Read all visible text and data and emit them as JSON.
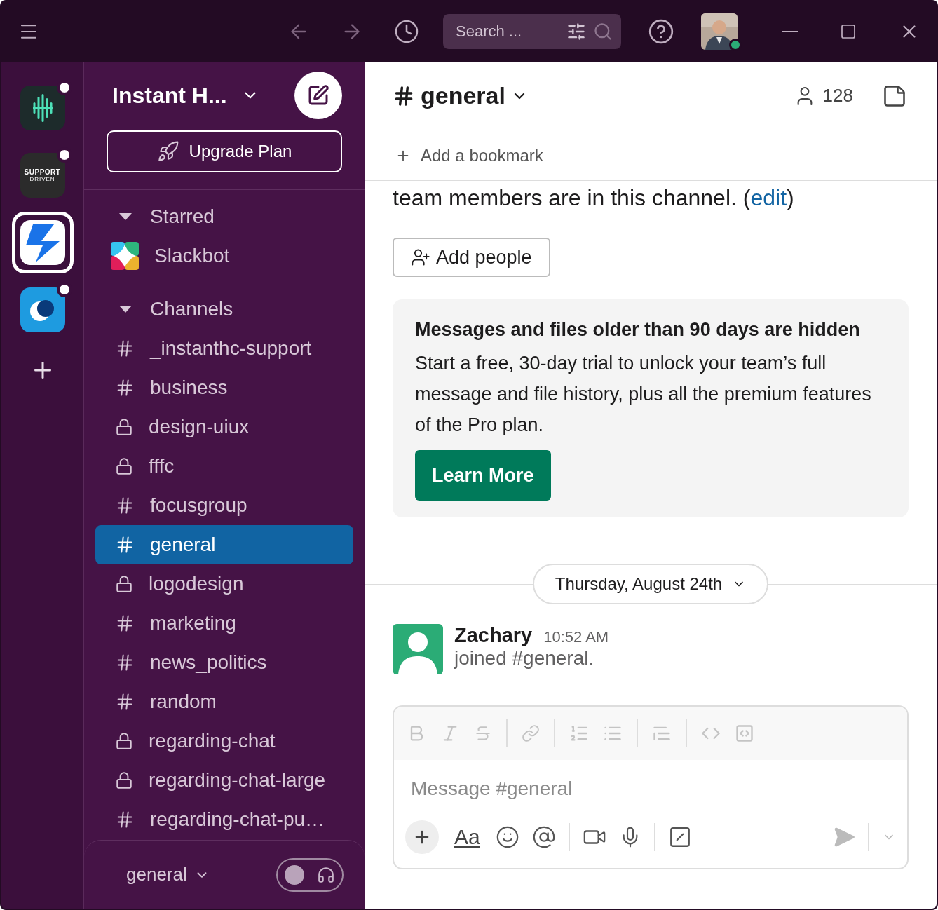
{
  "titlebar": {
    "search": {
      "placeholder": "Search ..."
    },
    "user_status": {
      "color": "#2bac76"
    }
  },
  "workspaces": [
    {
      "kind": "wave",
      "unread": true,
      "selected": false
    },
    {
      "kind": "support",
      "unread": true,
      "selected": false,
      "logo_text": "SUPPORT",
      "logo_sub": "DRIVEN"
    },
    {
      "kind": "bolt",
      "unread": false,
      "selected": true
    },
    {
      "kind": "rings",
      "unread": true,
      "selected": false
    }
  ],
  "sidebar": {
    "workspace_name": "Instant H...",
    "upgrade": "Upgrade Plan",
    "sections": [
      {
        "title": "Starred",
        "expanded": true,
        "items": [
          {
            "kind": "app",
            "label": "Slackbot",
            "selected": false
          }
        ]
      },
      {
        "title": "Channels",
        "expanded": true,
        "items": [
          {
            "kind": "public",
            "label": "_instanthc-support",
            "selected": false
          },
          {
            "kind": "public",
            "label": "business",
            "selected": false
          },
          {
            "kind": "private",
            "label": "design-uiux",
            "selected": false
          },
          {
            "kind": "private",
            "label": "fffc",
            "selected": false
          },
          {
            "kind": "public",
            "label": "focusgroup",
            "selected": false
          },
          {
            "kind": "public",
            "label": "general",
            "selected": true
          },
          {
            "kind": "private",
            "label": "logodesign",
            "selected": false
          },
          {
            "kind": "public",
            "label": "marketing",
            "selected": false
          },
          {
            "kind": "public",
            "label": "news_politics",
            "selected": false
          },
          {
            "kind": "public",
            "label": "random",
            "selected": false
          },
          {
            "kind": "private",
            "label": "regarding-chat",
            "selected": false
          },
          {
            "kind": "private",
            "label": "regarding-chat-large",
            "selected": false
          },
          {
            "kind": "public",
            "label": "regarding-chat-pu…",
            "selected": false
          }
        ]
      }
    ],
    "huddle": {
      "channel": "general",
      "on": false
    }
  },
  "channel": {
    "name": "general",
    "members": "128",
    "bookmark": "Add a bookmark",
    "intro": {
      "text": "team members are in this channel. (",
      "link": "edit",
      "after": ")"
    },
    "add_people": "Add people",
    "notice": {
      "title": "Messages and files older than 90 days are hidden",
      "body": "Start a free, 30-day trial to unlock your team’s full message and file history, plus all the premium features of the Pro plan.",
      "button": "Learn More"
    },
    "date": "Thursday, August 24th",
    "messages": [
      {
        "author": "Zachary",
        "time": "10:52 AM",
        "text": "joined #general."
      }
    ],
    "composer": {
      "placeholder": "Message #general",
      "format_label": "Aa"
    }
  }
}
